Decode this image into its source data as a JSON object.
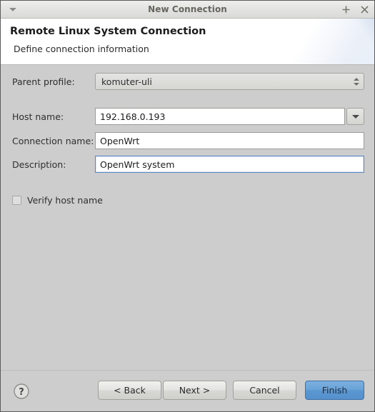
{
  "window": {
    "title": "New Connection",
    "menu_icon": "chevron-down-icon",
    "maximize_icon": "plus-icon",
    "close_icon": "close-icon"
  },
  "header": {
    "title": "Remote Linux System Connection",
    "subtitle": "Define connection information"
  },
  "form": {
    "parent_profile": {
      "label": "Parent profile:",
      "value": "komuter-uli"
    },
    "host_name": {
      "label": "Host name:",
      "value": "192.168.0.193",
      "placeholder": ""
    },
    "connection_name": {
      "label": "Connection name:",
      "value": "OpenWrt",
      "placeholder": ""
    },
    "description": {
      "label": "Description:",
      "value": "OpenWrt system",
      "placeholder": ""
    },
    "verify_host_name": {
      "label": "Verify host name",
      "checked": false
    }
  },
  "footer": {
    "help_icon": "question-mark-icon",
    "back_label": "< Back",
    "next_label": "Next >",
    "cancel_label": "Cancel",
    "finish_label": "Finish"
  },
  "colors": {
    "window_bg": "#cdcdcd",
    "titlebar_bg": "#e4e4e2",
    "header_bg": "#ffffff",
    "accent_blue": "#5a97d1",
    "focus_border": "#5b87c4",
    "header_gradient_blue": "#cbd7ec"
  }
}
